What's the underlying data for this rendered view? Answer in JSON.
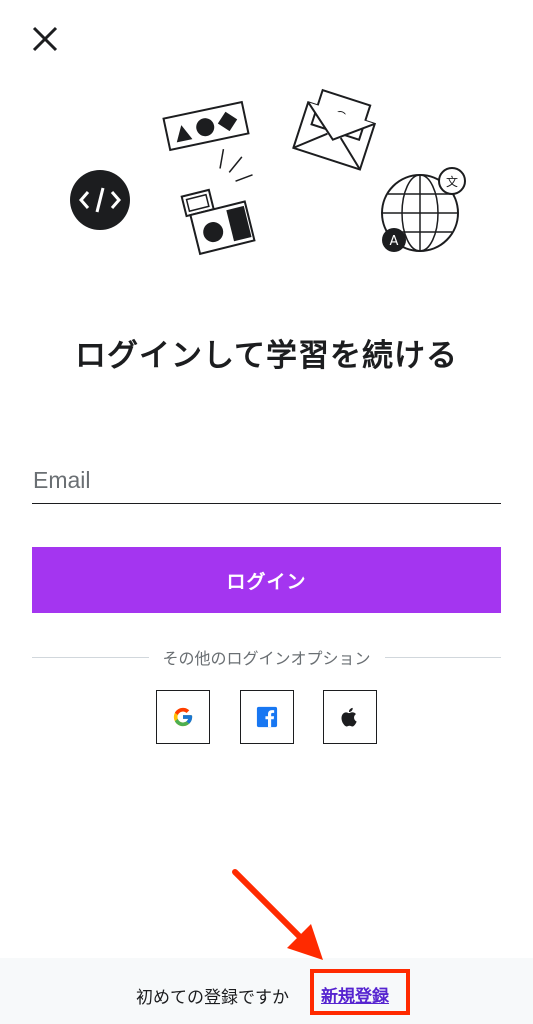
{
  "header": {
    "close_icon": "close-icon"
  },
  "illustration": {
    "icons": [
      "code-icon",
      "shapes-card-icon",
      "camera-icon",
      "envelope-icon",
      "globe-translate-icon"
    ],
    "translate_badge": "文",
    "language_badge": "A",
    "email_symbol": "@"
  },
  "title": "ログインして学習を続ける",
  "form": {
    "email_placeholder": "Email",
    "email_value": "",
    "login_label": "ログイン"
  },
  "divider": {
    "label": "その他のログインオプション"
  },
  "social": [
    {
      "name": "Google",
      "icon": "google-icon"
    },
    {
      "name": "Facebook",
      "icon": "facebook-icon"
    },
    {
      "name": "Apple",
      "icon": "apple-icon"
    }
  ],
  "footer": {
    "prompt": "初めての登録ですか",
    "signup_link": "新規登録"
  },
  "colors": {
    "primary": "#a435f0",
    "link": "#5624d0",
    "highlight": "#ff2a00",
    "text": "#1c1d1f",
    "muted": "#6a6f73"
  }
}
